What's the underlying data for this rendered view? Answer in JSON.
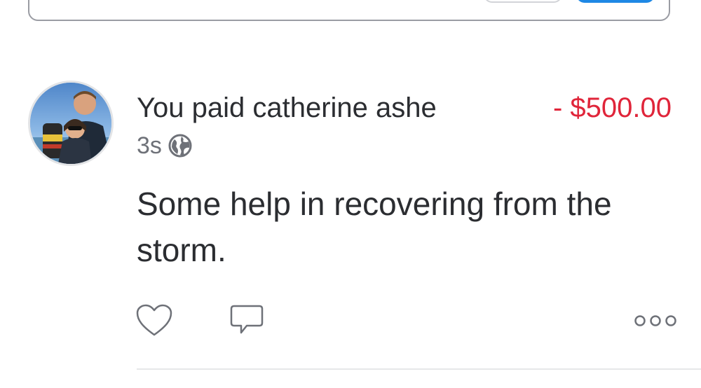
{
  "feed_item": {
    "headline_prefix": "You paid ",
    "recipient": "catherine ashe",
    "amount": "- $500.00",
    "time": "3s",
    "note": "Some help in recovering from the storm.",
    "privacy_icon": "globe-icon",
    "actions": {
      "like_icon": "heart-icon",
      "comment_icon": "comment-icon",
      "more_icon": "more-icon"
    }
  },
  "colors": {
    "amount_negative": "#e0253a",
    "text_primary": "#2b2d31",
    "text_secondary": "#6e7178",
    "icon_gray": "#6e7178",
    "primary_button": "#1e88e5"
  }
}
